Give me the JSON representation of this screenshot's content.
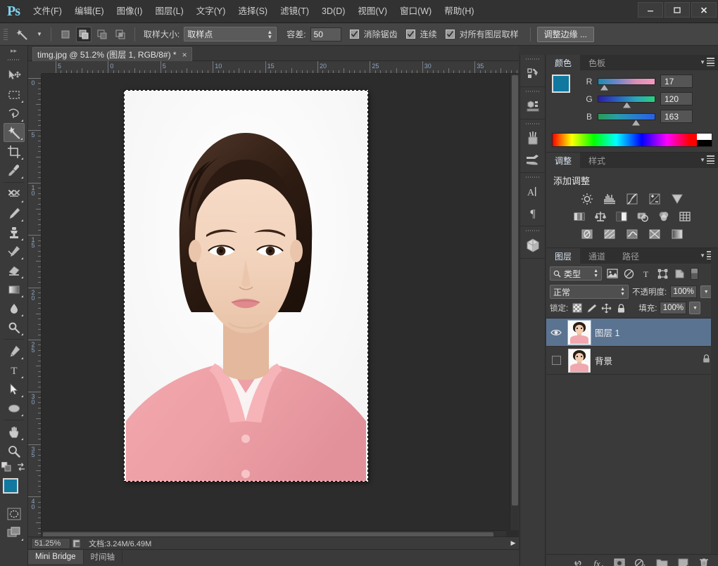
{
  "app": {
    "logo": "Ps",
    "menus": [
      {
        "label": "文件(F)"
      },
      {
        "label": "编辑(E)"
      },
      {
        "label": "图像(I)"
      },
      {
        "label": "图层(L)"
      },
      {
        "label": "文字(Y)"
      },
      {
        "label": "选择(S)"
      },
      {
        "label": "滤镜(T)"
      },
      {
        "label": "3D(D)"
      },
      {
        "label": "视图(V)"
      },
      {
        "label": "窗口(W)"
      },
      {
        "label": "帮助(H)"
      }
    ],
    "window_controls": {
      "minimize": "minimize-icon",
      "maximize": "maximize-icon",
      "close": "close-icon"
    }
  },
  "options_bar": {
    "tool_icon": "magic-wand-icon",
    "tool_preset_arrow": "chevron-down-icon",
    "selection_modes": [
      {
        "name": "new-selection",
        "active": false
      },
      {
        "name": "add-to-selection",
        "active": true
      },
      {
        "name": "subtract-from-selection",
        "active": false
      },
      {
        "name": "intersect-selection",
        "active": false
      }
    ],
    "sample_size_label": "取样大小:",
    "sample_size_value": "取样点",
    "tolerance_label": "容差:",
    "tolerance_value": "50",
    "checkboxes": [
      {
        "label": "消除锯齿",
        "checked": true
      },
      {
        "label": "连续",
        "checked": true
      },
      {
        "label": "对所有图层取样",
        "checked": true
      }
    ],
    "refine_edge_button": "调整边缘 ..."
  },
  "toolbar": {
    "collapse_icon": "double-chevron-right-icon",
    "tools": [
      {
        "name": "move-tool",
        "selected": false,
        "has_flyout": false
      },
      {
        "name": "rectangular-marquee-tool",
        "selected": false,
        "has_flyout": true
      },
      {
        "name": "lasso-tool",
        "selected": false,
        "has_flyout": true
      },
      {
        "name": "magic-wand-tool",
        "selected": true,
        "has_flyout": true
      },
      {
        "name": "crop-tool",
        "selected": false,
        "has_flyout": true
      },
      {
        "name": "eyedropper-tool",
        "selected": false,
        "has_flyout": true
      },
      {
        "name": "spot-healing-brush-tool",
        "selected": false,
        "has_flyout": true
      },
      {
        "name": "brush-tool",
        "selected": false,
        "has_flyout": true
      },
      {
        "name": "clone-stamp-tool",
        "selected": false,
        "has_flyout": true
      },
      {
        "name": "history-brush-tool",
        "selected": false,
        "has_flyout": true
      },
      {
        "name": "eraser-tool",
        "selected": false,
        "has_flyout": true
      },
      {
        "name": "gradient-tool",
        "selected": false,
        "has_flyout": true
      },
      {
        "name": "blur-tool",
        "selected": false,
        "has_flyout": true
      },
      {
        "name": "dodge-tool",
        "selected": false,
        "has_flyout": true
      },
      {
        "name": "pen-tool",
        "selected": false,
        "has_flyout": true
      },
      {
        "name": "horizontal-type-tool",
        "selected": false,
        "has_flyout": true
      },
      {
        "name": "path-selection-tool",
        "selected": false,
        "has_flyout": true
      },
      {
        "name": "ellipse-shape-tool",
        "selected": false,
        "has_flyout": true
      },
      {
        "name": "hand-tool",
        "selected": false,
        "has_flyout": true
      },
      {
        "name": "zoom-tool",
        "selected": false,
        "has_flyout": false
      }
    ],
    "default_colors_icon": "default-colors-icon",
    "swap_colors_icon": "swap-colors-icon",
    "foreground_color": "#1178a0",
    "background_color": "#1b2bd6",
    "quick_mask_icon": "quick-mask-icon",
    "screen_mode_icon": "screen-mode-icon"
  },
  "document": {
    "tab_title": "timg.jpg @ 51.2% (图层 1, RGB/8#) *",
    "tab_close": "×",
    "ruler_h_labels": [
      "5",
      "0",
      "5",
      "10",
      "15",
      "20",
      "25",
      "30",
      "35"
    ],
    "ruler_v_labels": [
      "0",
      "5",
      "10",
      "15",
      "20",
      "25",
      "30",
      "35",
      "40"
    ]
  },
  "status_bar": {
    "zoom_level": "51.25%",
    "thumbnail_icon": "document-thumb-icon",
    "doc_info": "文档:3.24M/6.49M",
    "expand_arrow": "play-arrow-icon"
  },
  "bottom_tabs": [
    {
      "label": "Mini Bridge",
      "active": true
    },
    {
      "label": "时间轴",
      "active": false
    }
  ],
  "dock_icons": [
    {
      "name": "history-panel-icon"
    },
    {
      "name": "3d-panel-icon"
    },
    {
      "name": "brush-presets-panel-icon"
    },
    {
      "name": "brush-panel-icon"
    },
    {
      "name": "character-panel-icon"
    },
    {
      "name": "paragraph-panel-icon"
    },
    {
      "name": "3d-object-panel-icon"
    }
  ],
  "color_panel": {
    "tabs": [
      {
        "label": "颜色",
        "active": true
      },
      {
        "label": "色板",
        "active": false
      }
    ],
    "menu_icon": "panel-menu-icon",
    "foreground_color": "#1178a0",
    "background_color": "#1b2bd6",
    "channels": [
      {
        "label": "R",
        "value": "17",
        "knob_pct": 7
      },
      {
        "label": "G",
        "value": "120",
        "knob_pct": 47
      },
      {
        "label": "B",
        "value": "163",
        "knob_pct": 64
      }
    ]
  },
  "adjustments_panel": {
    "tabs": [
      {
        "label": "调整",
        "active": true
      },
      {
        "label": "样式",
        "active": false
      }
    ],
    "menu_icon": "panel-menu-icon",
    "title": "添加调整",
    "buttons": [
      [
        {
          "name": "brightness-contrast-icon"
        },
        {
          "name": "levels-icon"
        },
        {
          "name": "curves-icon"
        },
        {
          "name": "exposure-icon"
        },
        {
          "name": "vibrance-icon"
        }
      ],
      [
        {
          "name": "hue-saturation-icon"
        },
        {
          "name": "color-balance-icon"
        },
        {
          "name": "black-white-icon"
        },
        {
          "name": "photo-filter-icon"
        },
        {
          "name": "channel-mixer-icon"
        },
        {
          "name": "color-lookup-icon"
        }
      ],
      [
        {
          "name": "invert-icon"
        },
        {
          "name": "posterize-icon"
        },
        {
          "name": "threshold-icon"
        },
        {
          "name": "gradient-map-icon"
        },
        {
          "name": "selective-color-icon"
        }
      ]
    ]
  },
  "layers_panel": {
    "tabs": [
      {
        "label": "图层",
        "active": true
      },
      {
        "label": "通道",
        "active": false
      },
      {
        "label": "路径",
        "active": false
      }
    ],
    "menu_icon": "panel-menu-icon",
    "filter": {
      "search_icon": "search-icon",
      "type_label": "类型",
      "icons": [
        {
          "name": "filter-pixel-icon"
        },
        {
          "name": "filter-adjustment-icon"
        },
        {
          "name": "filter-type-icon"
        },
        {
          "name": "filter-shape-icon"
        },
        {
          "name": "filter-smartobject-icon"
        }
      ],
      "toggle": "filter-toggle-switch"
    },
    "blend_mode": "正常",
    "opacity_label": "不透明度:",
    "opacity_value": "100%",
    "lock_label": "锁定:",
    "lock_icons": [
      {
        "name": "lock-transparency-icon"
      },
      {
        "name": "lock-image-icon"
      },
      {
        "name": "lock-position-icon"
      },
      {
        "name": "lock-all-icon"
      }
    ],
    "fill_label": "填充:",
    "fill_value": "100%",
    "layers": [
      {
        "name": "图层 1",
        "visible": true,
        "selected": true,
        "locked": false
      },
      {
        "name": "背景",
        "visible": false,
        "selected": false,
        "locked": true
      }
    ],
    "footer_icons": [
      {
        "name": "link-layers-icon"
      },
      {
        "name": "layer-style-fx-icon"
      },
      {
        "name": "add-layer-mask-icon"
      },
      {
        "name": "new-fill-adjustment-icon"
      },
      {
        "name": "new-group-icon"
      },
      {
        "name": "new-layer-icon"
      },
      {
        "name": "delete-layer-icon"
      }
    ]
  },
  "canvas": {
    "image_alt": "portrait-photo-woman-pink-shirt",
    "selection_active": true
  }
}
